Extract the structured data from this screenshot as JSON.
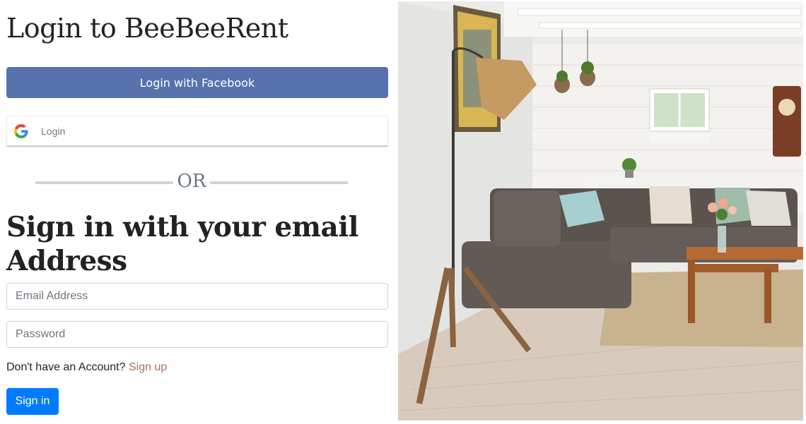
{
  "page": {
    "title": "Login to BeeBeeRent"
  },
  "social": {
    "facebook_label": "Login with Facebook",
    "google_label": "Login",
    "google_icon": "google-g-icon"
  },
  "divider": {
    "text": "OR"
  },
  "email_form": {
    "heading": "Sign in with your email Address",
    "email_placeholder": "Email Address",
    "password_placeholder": "Password",
    "signup_prompt": "Don't have an Account?",
    "signup_link": "Sign up",
    "submit_label": "Sign in"
  },
  "colors": {
    "facebook": "#5872ad",
    "primary": "#007bff",
    "link": "#a0735a"
  }
}
